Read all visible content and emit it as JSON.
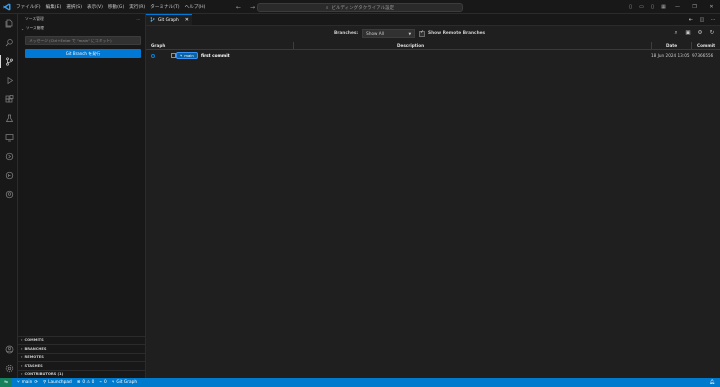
{
  "titlebar": {
    "menu": [
      "ファイル(F)",
      "編集(E)",
      "選択(S)",
      "表示(V)",
      "移動(G)",
      "実行(R)",
      "ターミナル(T)",
      "ヘルプ(H)"
    ],
    "search_placeholder": "ビルディングタクライアル設定"
  },
  "sidebar": {
    "title": "ソース管理",
    "section": "ソース管理",
    "message_placeholder": "メッセージ (Ctrl+Enter で \"main\" にコミット)",
    "button": "Git Branch を発行",
    "sections": [
      "COMMITS",
      "BRANCHES",
      "REMOTES",
      "STASHES",
      "CONTRIBUTORS (1)"
    ]
  },
  "editor": {
    "tab_label": "Git Graph",
    "branches_label": "Branches:",
    "branches_value": "Show All",
    "show_remote_label": "Show Remote Branches",
    "columns": {
      "graph": "Graph",
      "description": "Description",
      "date": "Date",
      "commit": "Commit"
    },
    "rows": [
      {
        "ref": "main",
        "message": "first commit",
        "date": "18 Jun 2024 13:05",
        "commit": "97366556"
      }
    ]
  },
  "statusbar": {
    "branch": "main",
    "launchpad": "Launchpad",
    "problems": "0 ⚠ 0",
    "ports": "0",
    "git_graph": "Git Graph"
  }
}
